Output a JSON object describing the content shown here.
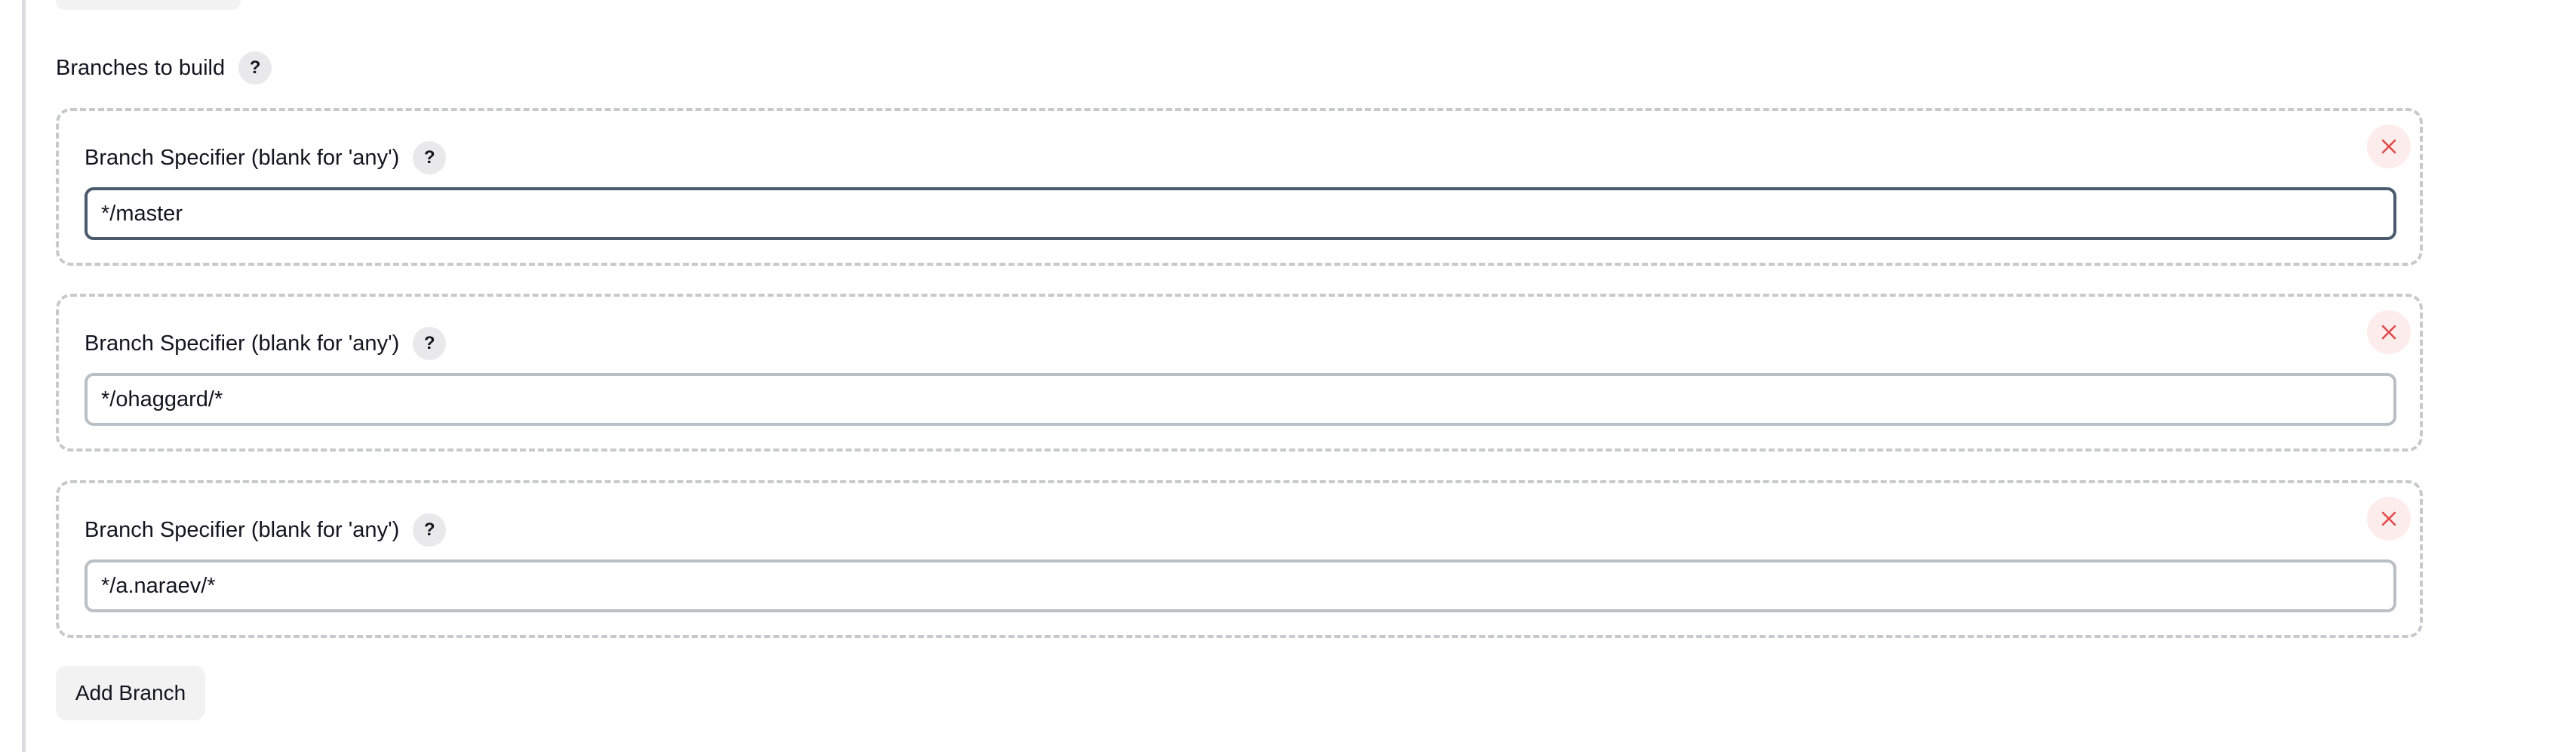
{
  "section": {
    "title": "Branches to build",
    "help": "?"
  },
  "branches": [
    {
      "label": "Branch Specifier (blank for 'any')",
      "help": "?",
      "value": "*/master"
    },
    {
      "label": "Branch Specifier (blank for 'any')",
      "help": "?",
      "value": "*/ohaggard/*"
    },
    {
      "label": "Branch Specifier (blank for 'any')",
      "help": "?",
      "value": "*/a.naraev/*"
    }
  ],
  "add_branch_label": "Add Branch",
  "colors": {
    "remove_icon": "#e04b4b",
    "remove_bg": "#fdecec",
    "focused_border": "#4b5b6d",
    "input_border": "#babfc4",
    "dashed_border": "#c8c9cc"
  },
  "icons": {
    "remove": "close-icon",
    "help": "help-icon"
  }
}
